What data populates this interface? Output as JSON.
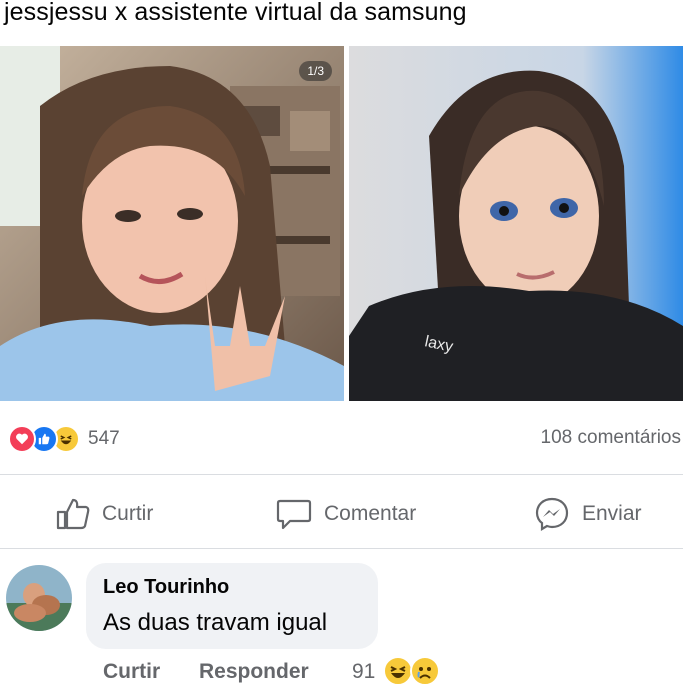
{
  "caption": "jessjessu x assistente virtual da samsung",
  "photo": {
    "counter": "1/3",
    "shirt_text": "laxy"
  },
  "reactions": {
    "icons": [
      "love-icon",
      "like-icon",
      "haha-icon"
    ],
    "count": "547",
    "comments": "108 comentários"
  },
  "actions": {
    "like": "Curtir",
    "comment": "Comentar",
    "send": "Enviar"
  },
  "comment": {
    "author": "Leo Tourinho",
    "text": "As duas travam igual",
    "like_label": "Curtir",
    "reply_label": "Responder",
    "reaction_count": "91",
    "reaction_icons": [
      "haha-icon",
      "sad-icon"
    ]
  },
  "colors": {
    "like_blue": "#1877f2",
    "love_red": "#f33e58",
    "haha_yellow": "#f7c93a",
    "muted_text": "#65676b",
    "bubble_bg": "#f0f2f5"
  }
}
